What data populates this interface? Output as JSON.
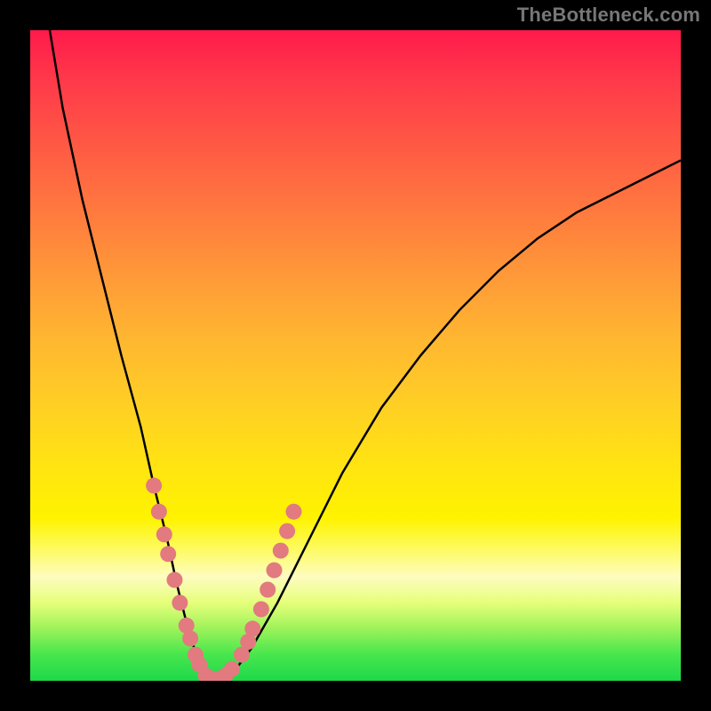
{
  "watermark": "TheBottleneck.com",
  "chart_data": {
    "type": "line",
    "title": "",
    "xlabel": "",
    "ylabel": "",
    "xlim": [
      0,
      100
    ],
    "ylim": [
      0,
      100
    ],
    "grid": false,
    "legend": false,
    "series": [
      {
        "name": "bottleneck-curve",
        "x": [
          3,
          5,
          8,
          11,
          14,
          17,
          19,
          21,
          22.5,
          24,
          25.5,
          27,
          29,
          31,
          34,
          38,
          43,
          48,
          54,
          60,
          66,
          72,
          78,
          84,
          90,
          96,
          100
        ],
        "y": [
          100,
          88,
          74,
          62,
          50,
          39,
          30,
          22,
          15,
          9,
          4,
          1,
          0,
          1,
          5,
          12,
          22,
          32,
          42,
          50,
          57,
          63,
          68,
          72,
          75,
          78,
          80
        ]
      }
    ],
    "markers": {
      "name": "highlight-dots",
      "color": "#e27a7f",
      "points": [
        {
          "x": 19.0,
          "y": 30
        },
        {
          "x": 19.8,
          "y": 26
        },
        {
          "x": 20.6,
          "y": 22.5
        },
        {
          "x": 21.2,
          "y": 19.5
        },
        {
          "x": 22.2,
          "y": 15.5
        },
        {
          "x": 23.0,
          "y": 12
        },
        {
          "x": 24.0,
          "y": 8.5
        },
        {
          "x": 24.6,
          "y": 6.5
        },
        {
          "x": 25.4,
          "y": 4
        },
        {
          "x": 26.0,
          "y": 2.5
        },
        {
          "x": 27.0,
          "y": 0.8
        },
        {
          "x": 28.0,
          "y": 0.3
        },
        {
          "x": 29.0,
          "y": 0.3
        },
        {
          "x": 30.0,
          "y": 0.8
        },
        {
          "x": 31.0,
          "y": 1.8
        },
        {
          "x": 32.5,
          "y": 4
        },
        {
          "x": 33.5,
          "y": 6
        },
        {
          "x": 34.2,
          "y": 8
        },
        {
          "x": 35.5,
          "y": 11
        },
        {
          "x": 36.5,
          "y": 14
        },
        {
          "x": 37.5,
          "y": 17
        },
        {
          "x": 38.5,
          "y": 20
        },
        {
          "x": 39.5,
          "y": 23
        },
        {
          "x": 40.5,
          "y": 26
        }
      ]
    },
    "gradient_stops": [
      {
        "pos": 0,
        "color": "#ff1a4b"
      },
      {
        "pos": 50,
        "color": "#ffd024"
      },
      {
        "pos": 75,
        "color": "#fff300"
      },
      {
        "pos": 100,
        "color": "#1fd84a"
      }
    ]
  }
}
